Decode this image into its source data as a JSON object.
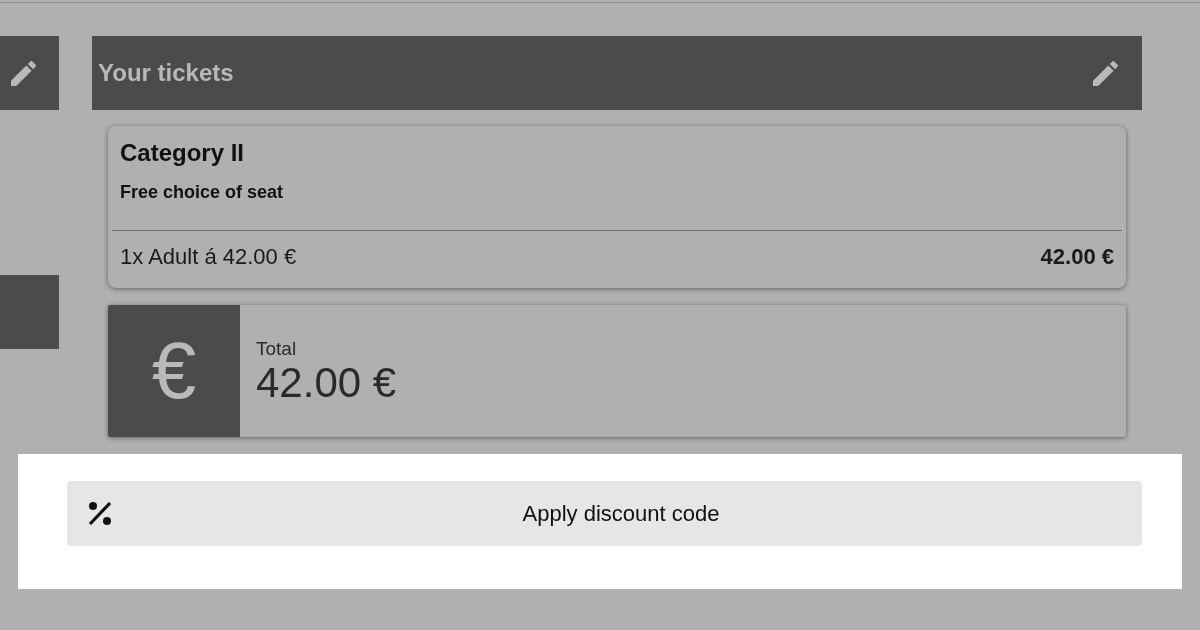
{
  "tickets_section": {
    "title": "Your tickets"
  },
  "ticket": {
    "category": "Category II",
    "description": "Free choice of seat",
    "line_item": "1x Adult á 42.00 €",
    "line_total": "42.00 €"
  },
  "total": {
    "currency_sign": "€",
    "label": "Total",
    "amount": "42.00 €"
  },
  "discount_button": {
    "label": "Apply discount code"
  }
}
